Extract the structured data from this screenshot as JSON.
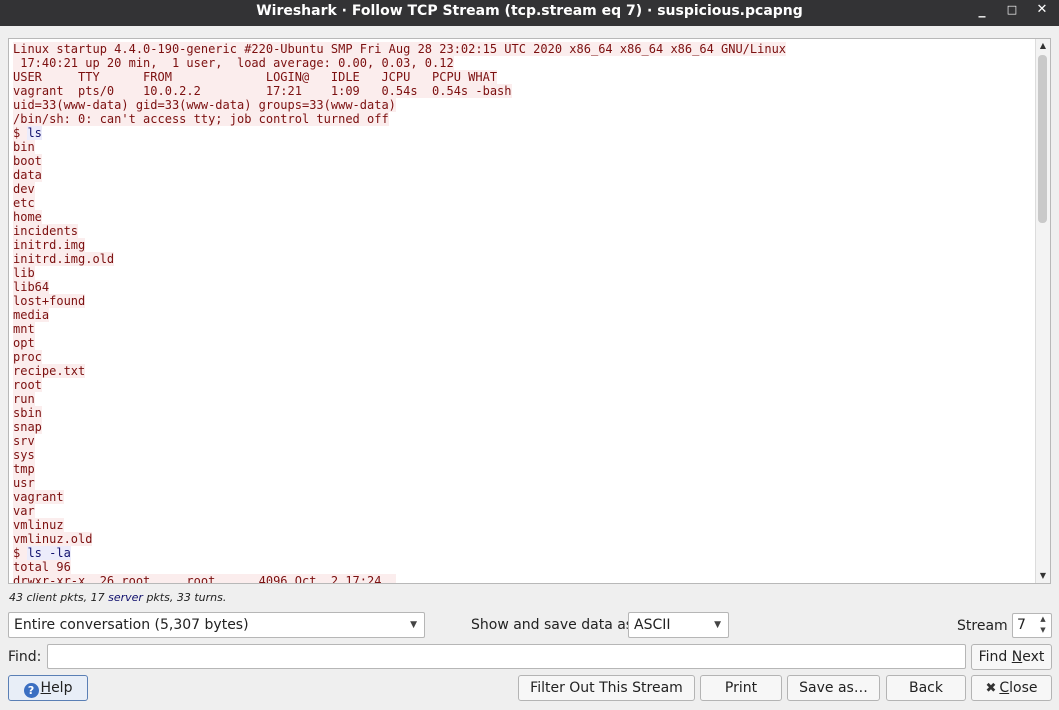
{
  "window": {
    "title": "Wireshark · Follow TCP Stream (tcp.stream eq 7) · suspicious.pcapng",
    "minimize_glyph": "_",
    "maximize_glyph": "□",
    "close_glyph": "✕"
  },
  "stream": {
    "lines": [
      {
        "side": "server",
        "text": "Linux startup 4.4.0-190-generic #220-Ubuntu SMP Fri Aug 28 23:02:15 UTC 2020 x86_64 x86_64 x86_64 GNU/Linux"
      },
      {
        "side": "server",
        "text": " 17:40:21 up 20 min,  1 user,  load average: 0.00, 0.03, 0.12"
      },
      {
        "side": "server",
        "text": "USER     TTY      FROM             LOGIN@   IDLE   JCPU   PCPU WHAT"
      },
      {
        "side": "server",
        "text": "vagrant  pts/0    10.0.2.2         17:21    1:09   0.54s  0.54s -bash"
      },
      {
        "side": "server",
        "text": "uid=33(www-data) gid=33(www-data) groups=33(www-data)"
      },
      {
        "side": "server",
        "text": "/bin/sh: 0: can't access tty; job control turned off"
      },
      {
        "side": "mixed",
        "prompt": "$ ",
        "command": "ls"
      },
      {
        "side": "server",
        "text": "bin"
      },
      {
        "side": "server",
        "text": "boot"
      },
      {
        "side": "server",
        "text": "data"
      },
      {
        "side": "server",
        "text": "dev"
      },
      {
        "side": "server",
        "text": "etc"
      },
      {
        "side": "server",
        "text": "home"
      },
      {
        "side": "server",
        "text": "incidents"
      },
      {
        "side": "server",
        "text": "initrd.img"
      },
      {
        "side": "server",
        "text": "initrd.img.old"
      },
      {
        "side": "server",
        "text": "lib"
      },
      {
        "side": "server",
        "text": "lib64"
      },
      {
        "side": "server",
        "text": "lost+found"
      },
      {
        "side": "server",
        "text": "media"
      },
      {
        "side": "server",
        "text": "mnt"
      },
      {
        "side": "server",
        "text": "opt"
      },
      {
        "side": "server",
        "text": "proc"
      },
      {
        "side": "server",
        "text": "recipe.txt"
      },
      {
        "side": "server",
        "text": "root"
      },
      {
        "side": "server",
        "text": "run"
      },
      {
        "side": "server",
        "text": "sbin"
      },
      {
        "side": "server",
        "text": "snap"
      },
      {
        "side": "server",
        "text": "srv"
      },
      {
        "side": "server",
        "text": "sys"
      },
      {
        "side": "server",
        "text": "tmp"
      },
      {
        "side": "server",
        "text": "usr"
      },
      {
        "side": "server",
        "text": "vagrant"
      },
      {
        "side": "server",
        "text": "var"
      },
      {
        "side": "server",
        "text": "vmlinuz"
      },
      {
        "side": "server",
        "text": "vmlinuz.old"
      },
      {
        "side": "mixed",
        "prompt": "$ ",
        "command": "ls -la"
      },
      {
        "side": "server",
        "text": "total 96"
      },
      {
        "side": "server",
        "text": "drwxr-xr-x  26 root     root      4096 Oct  2 17:24 ."
      }
    ]
  },
  "summary": {
    "client_count": "43",
    "client_word": "client",
    "server_count": "17",
    "server_word": "server",
    "turns_text": "pkts, 33 turns.",
    "pkts_word": "pkts,"
  },
  "controls": {
    "conversation_value": "Entire conversation (5,307 bytes)",
    "show_save_label": "Show and save data as",
    "encoding_value": "ASCII",
    "stream_label": "Stream",
    "stream_value": "7",
    "find_label": "Find:",
    "find_value": "",
    "find_next_pre": "Find ",
    "find_next_u": "N",
    "find_next_post": "ext"
  },
  "buttons": {
    "help_pre": "",
    "help_u": "H",
    "help_post": "elp",
    "filter_out": "Filter Out This Stream",
    "print": "Print",
    "save_as": "Save as…",
    "back": "Back",
    "close_u": "C",
    "close_post": "lose"
  },
  "colors": {
    "server_fg": "#7c1010",
    "server_bg": "#fbeded",
    "client_fg": "#11116e",
    "client_bg": "#ececfb",
    "titlebar_bg": "#333335"
  }
}
